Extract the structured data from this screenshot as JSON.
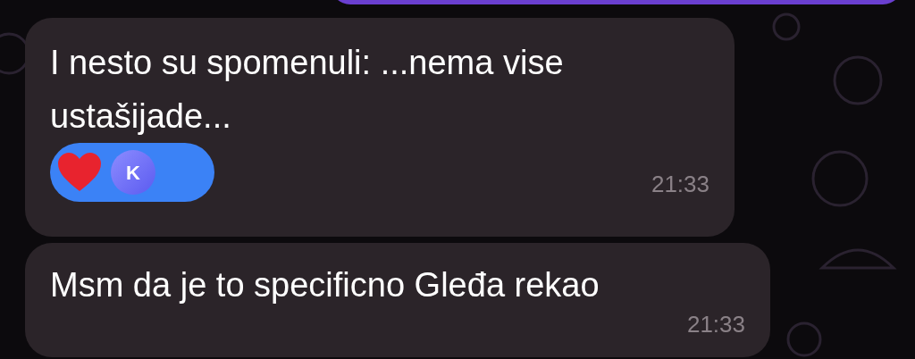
{
  "messages": [
    {
      "text": "I nesto su spomenuli: ...nema vise ustašijade...",
      "time": "21:33",
      "reactions": [
        {
          "kind": "heart"
        },
        {
          "kind": "avatar",
          "label": "K"
        }
      ]
    },
    {
      "text": "Msm da je to specificno Gleđa rekao",
      "time": "21:33"
    }
  ]
}
